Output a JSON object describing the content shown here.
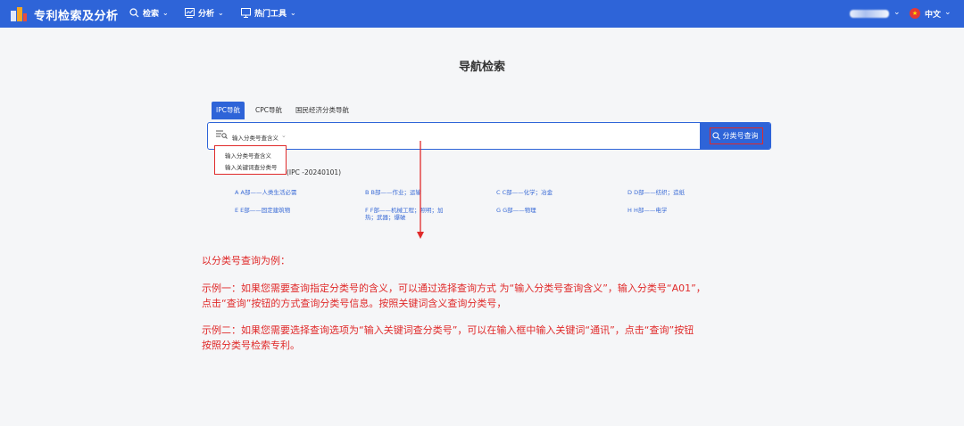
{
  "header": {
    "app_title": "专利检索及分析",
    "nav": [
      {
        "label": "检索",
        "icon": "search-icon"
      },
      {
        "label": "分析",
        "icon": "chart-icon"
      },
      {
        "label": "热门工具",
        "icon": "monitor-icon"
      }
    ],
    "language": "中文",
    "colors": {
      "bar": "#2e64d8",
      "text": "#ffffff"
    }
  },
  "page": {
    "title": "导航检索"
  },
  "tabs": [
    {
      "label": "IPC导航",
      "active": true
    },
    {
      "label": "CPC导航",
      "active": false
    },
    {
      "label": "国民经济分类导航",
      "active": false
    }
  ],
  "search": {
    "selected_mode": "输入分类号查含义",
    "button_label": "分类号查询"
  },
  "dropdown": {
    "options": [
      "输入分类号查含义",
      "输入关键词查分类号"
    ]
  },
  "version_label": "(IPC -20240101)",
  "categories": [
    "A A部——人类生活必需",
    "B B部——作业；运输",
    "C C部——化学；冶金",
    "D D部——纺织；造纸",
    "E E部——固定建筑物",
    "F F部——机械工程；照明；加热；武器；爆破",
    "G G部——物理",
    "H H部——电学"
  ],
  "instructions": {
    "heading": "以分类号查询为例：",
    "example1_line1": "示例一：如果您需要查询指定分类号的含义，可以通过选择查询方式 为“输入分类号查询含义”，输入分类号“A01”，",
    "example1_line2": "点击“查询”按钮的方式查询分类号信息。按照关键词含义查询分类号，",
    "example2_line1": "示例二：如果您需要选择查询选项为“输入关键词查分类号”，可以在输入框中输入关键词“通讯”，点击“查询”按钮",
    "example2_line2": "按照分类号检索专利。"
  },
  "colors": {
    "accent": "#2e64d8",
    "annotation": "#e02a2a",
    "link": "#3a6bd6"
  }
}
